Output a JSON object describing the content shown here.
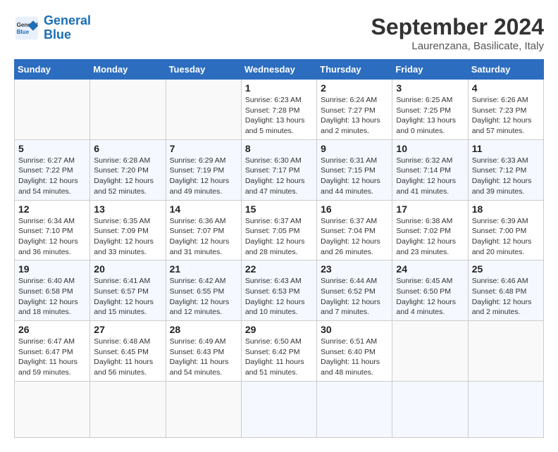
{
  "header": {
    "logo_line1": "General",
    "logo_line2": "Blue",
    "month_year": "September 2024",
    "location": "Laurenzana, Basilicate, Italy"
  },
  "weekdays": [
    "Sunday",
    "Monday",
    "Tuesday",
    "Wednesday",
    "Thursday",
    "Friday",
    "Saturday"
  ],
  "days": [
    {
      "num": "",
      "info": ""
    },
    {
      "num": "",
      "info": ""
    },
    {
      "num": "",
      "info": ""
    },
    {
      "num": "1",
      "info": "Sunrise: 6:23 AM\nSunset: 7:28 PM\nDaylight: 13 hours\nand 5 minutes."
    },
    {
      "num": "2",
      "info": "Sunrise: 6:24 AM\nSunset: 7:27 PM\nDaylight: 13 hours\nand 2 minutes."
    },
    {
      "num": "3",
      "info": "Sunrise: 6:25 AM\nSunset: 7:25 PM\nDaylight: 13 hours\nand 0 minutes."
    },
    {
      "num": "4",
      "info": "Sunrise: 6:26 AM\nSunset: 7:23 PM\nDaylight: 12 hours\nand 57 minutes."
    },
    {
      "num": "5",
      "info": "Sunrise: 6:27 AM\nSunset: 7:22 PM\nDaylight: 12 hours\nand 54 minutes."
    },
    {
      "num": "6",
      "info": "Sunrise: 6:28 AM\nSunset: 7:20 PM\nDaylight: 12 hours\nand 52 minutes."
    },
    {
      "num": "7",
      "info": "Sunrise: 6:29 AM\nSunset: 7:19 PM\nDaylight: 12 hours\nand 49 minutes."
    },
    {
      "num": "8",
      "info": "Sunrise: 6:30 AM\nSunset: 7:17 PM\nDaylight: 12 hours\nand 47 minutes."
    },
    {
      "num": "9",
      "info": "Sunrise: 6:31 AM\nSunset: 7:15 PM\nDaylight: 12 hours\nand 44 minutes."
    },
    {
      "num": "10",
      "info": "Sunrise: 6:32 AM\nSunset: 7:14 PM\nDaylight: 12 hours\nand 41 minutes."
    },
    {
      "num": "11",
      "info": "Sunrise: 6:33 AM\nSunset: 7:12 PM\nDaylight: 12 hours\nand 39 minutes."
    },
    {
      "num": "12",
      "info": "Sunrise: 6:34 AM\nSunset: 7:10 PM\nDaylight: 12 hours\nand 36 minutes."
    },
    {
      "num": "13",
      "info": "Sunrise: 6:35 AM\nSunset: 7:09 PM\nDaylight: 12 hours\nand 33 minutes."
    },
    {
      "num": "14",
      "info": "Sunrise: 6:36 AM\nSunset: 7:07 PM\nDaylight: 12 hours\nand 31 minutes."
    },
    {
      "num": "15",
      "info": "Sunrise: 6:37 AM\nSunset: 7:05 PM\nDaylight: 12 hours\nand 28 minutes."
    },
    {
      "num": "16",
      "info": "Sunrise: 6:37 AM\nSunset: 7:04 PM\nDaylight: 12 hours\nand 26 minutes."
    },
    {
      "num": "17",
      "info": "Sunrise: 6:38 AM\nSunset: 7:02 PM\nDaylight: 12 hours\nand 23 minutes."
    },
    {
      "num": "18",
      "info": "Sunrise: 6:39 AM\nSunset: 7:00 PM\nDaylight: 12 hours\nand 20 minutes."
    },
    {
      "num": "19",
      "info": "Sunrise: 6:40 AM\nSunset: 6:58 PM\nDaylight: 12 hours\nand 18 minutes."
    },
    {
      "num": "20",
      "info": "Sunrise: 6:41 AM\nSunset: 6:57 PM\nDaylight: 12 hours\nand 15 minutes."
    },
    {
      "num": "21",
      "info": "Sunrise: 6:42 AM\nSunset: 6:55 PM\nDaylight: 12 hours\nand 12 minutes."
    },
    {
      "num": "22",
      "info": "Sunrise: 6:43 AM\nSunset: 6:53 PM\nDaylight: 12 hours\nand 10 minutes."
    },
    {
      "num": "23",
      "info": "Sunrise: 6:44 AM\nSunset: 6:52 PM\nDaylight: 12 hours\nand 7 minutes."
    },
    {
      "num": "24",
      "info": "Sunrise: 6:45 AM\nSunset: 6:50 PM\nDaylight: 12 hours\nand 4 minutes."
    },
    {
      "num": "25",
      "info": "Sunrise: 6:46 AM\nSunset: 6:48 PM\nDaylight: 12 hours\nand 2 minutes."
    },
    {
      "num": "26",
      "info": "Sunrise: 6:47 AM\nSunset: 6:47 PM\nDaylight: 11 hours\nand 59 minutes."
    },
    {
      "num": "27",
      "info": "Sunrise: 6:48 AM\nSunset: 6:45 PM\nDaylight: 11 hours\nand 56 minutes."
    },
    {
      "num": "28",
      "info": "Sunrise: 6:49 AM\nSunset: 6:43 PM\nDaylight: 11 hours\nand 54 minutes."
    },
    {
      "num": "29",
      "info": "Sunrise: 6:50 AM\nSunset: 6:42 PM\nDaylight: 11 hours\nand 51 minutes."
    },
    {
      "num": "30",
      "info": "Sunrise: 6:51 AM\nSunset: 6:40 PM\nDaylight: 11 hours\nand 48 minutes."
    },
    {
      "num": "",
      "info": ""
    },
    {
      "num": "",
      "info": ""
    },
    {
      "num": "",
      "info": ""
    },
    {
      "num": "",
      "info": ""
    },
    {
      "num": "",
      "info": ""
    }
  ]
}
